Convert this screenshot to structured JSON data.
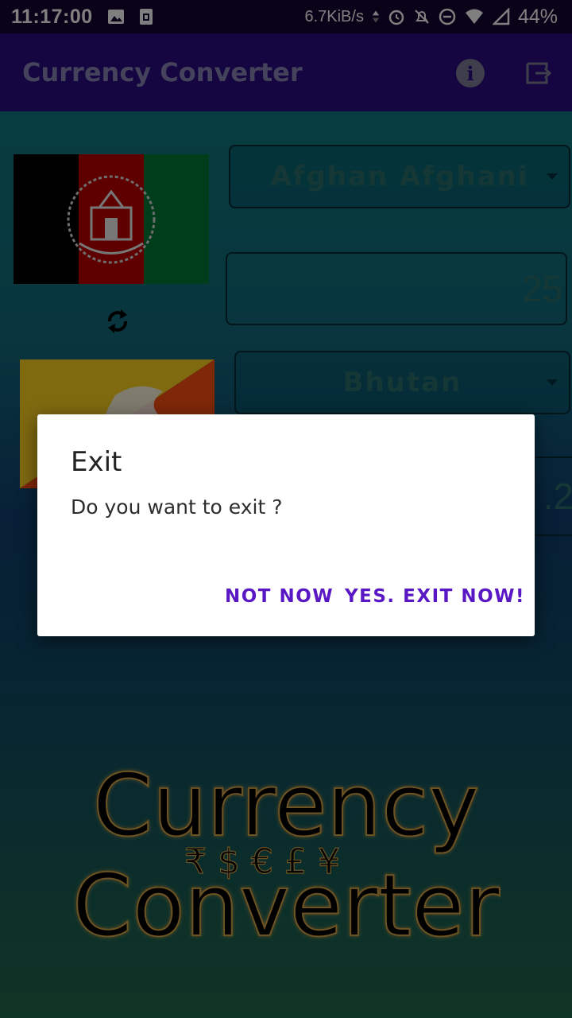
{
  "status_bar": {
    "time": "11:17:00",
    "net_speed": "6.7KiB/s",
    "battery": "44%"
  },
  "app_bar": {
    "title": "Currency Converter",
    "info_icon": "info-icon",
    "exit_icon": "exit-icon"
  },
  "converter": {
    "from_currency": "Afghan Afghani",
    "amount": "25",
    "to_currency": "Bhutan",
    "result_partial": ".2",
    "swap_icon": "swap-icon"
  },
  "logo": {
    "line1": "Currency",
    "symbols": "₹ $ € £ ¥",
    "line2": "Converter"
  },
  "dialog": {
    "title": "Exit",
    "message": "Do you want to exit ?",
    "negative_label": "NOT NOW",
    "positive_label": "YES. EXIT NOW!"
  },
  "colors": {
    "app_bar": "#2a0a82",
    "status_bar": "#120530",
    "dialog_button": "#5a18c4"
  }
}
